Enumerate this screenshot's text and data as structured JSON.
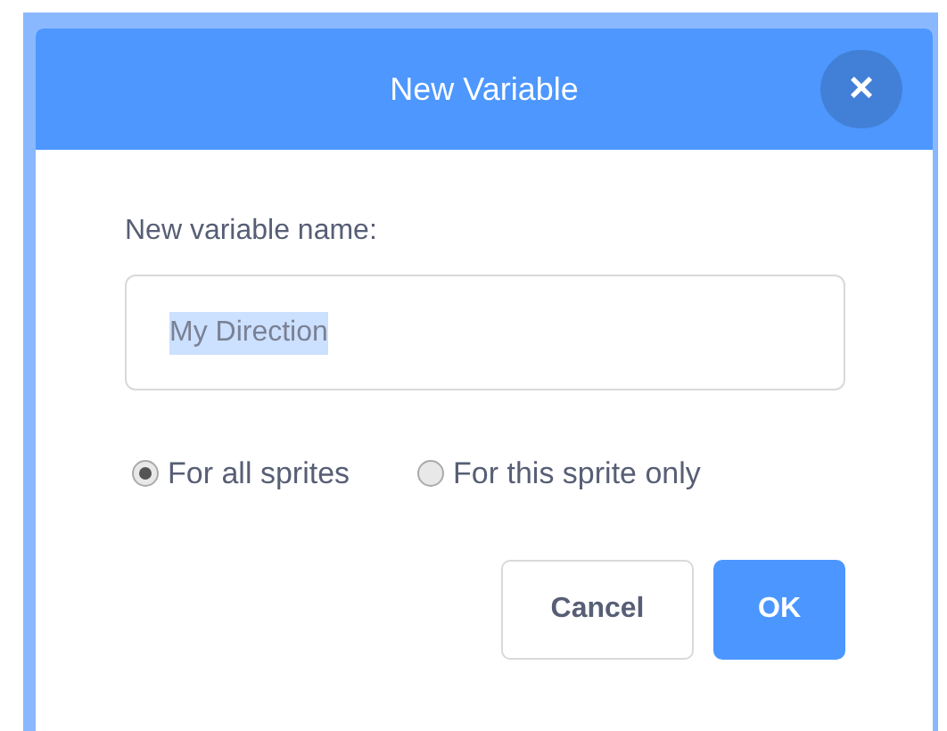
{
  "dialog": {
    "title": "New Variable",
    "close_label": "×"
  },
  "field": {
    "label": "New variable name:",
    "value": "My Direction",
    "value_selected": true
  },
  "scope_options": [
    {
      "label": "For all sprites",
      "selected": true
    },
    {
      "label": "For this sprite only",
      "selected": false
    }
  ],
  "buttons": [
    {
      "label": "Cancel",
      "kind": "secondary"
    },
    {
      "label": "OK",
      "kind": "primary"
    }
  ]
}
